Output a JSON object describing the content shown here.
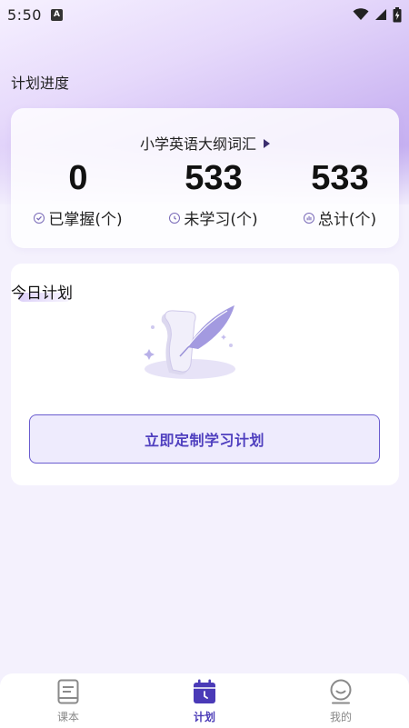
{
  "status_bar": {
    "time": "5:50",
    "notification_icon": "A"
  },
  "section_title": "计划进度",
  "progress": {
    "book_name": "小学英语大纲词汇",
    "stats": [
      {
        "value": "0",
        "label": "已掌握(个)",
        "icon": "check-circle-icon"
      },
      {
        "value": "533",
        "label": "未学习(个)",
        "icon": "clock-icon"
      },
      {
        "value": "533",
        "label": "总计(个)",
        "icon": "bar-chart-icon"
      }
    ]
  },
  "today_plan": {
    "title": "今日计划",
    "button_label": "立即定制学习计划"
  },
  "bottom_nav": [
    {
      "label": "课本",
      "icon": "book-icon",
      "active": false
    },
    {
      "label": "计划",
      "icon": "calendar-icon",
      "active": true
    },
    {
      "label": "我的",
      "icon": "profile-icon",
      "active": false
    }
  ],
  "colors": {
    "accent": "#4a3ab7",
    "button_bg": "#eeebfd",
    "button_border": "#6a5ccf"
  }
}
